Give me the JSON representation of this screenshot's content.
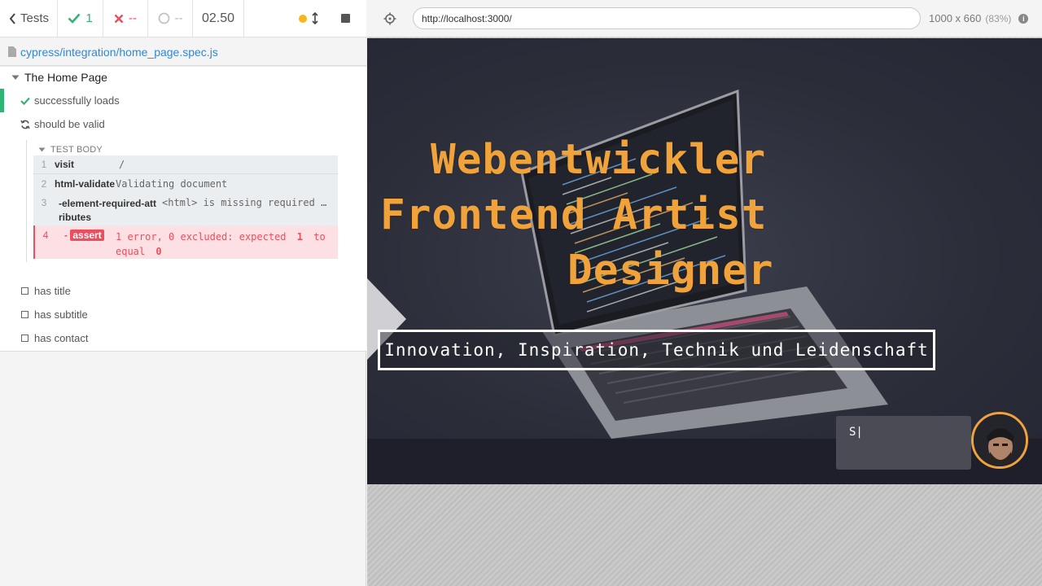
{
  "reporter": {
    "back_label": "Tests",
    "passed_count": "1",
    "failed_count": "--",
    "pending_count": "--",
    "duration": "02.50",
    "spec_path": "cypress/integration/home_page.spec.js",
    "suite_title": "The Home Page",
    "tests": [
      {
        "title": "successfully loads",
        "state": "passed"
      },
      {
        "title": "should be valid",
        "state": "running"
      },
      {
        "title": "has title",
        "state": "pending"
      },
      {
        "title": "has subtitle",
        "state": "pending"
      },
      {
        "title": "has contact",
        "state": "pending"
      }
    ],
    "test_body_label": "TEST BODY",
    "commands": [
      {
        "num": "1",
        "name": "visit",
        "message": "/"
      },
      {
        "num": "2",
        "name": "html-validate",
        "message": "Validating document"
      },
      {
        "num": "3",
        "name": "-element-required-attributes",
        "message": "<html> is missing required …"
      },
      {
        "num": "4",
        "prefix": "-",
        "name": "assert",
        "message": "1 error, 0 excluded: expected",
        "expected": "1",
        "to": "to",
        "equal": "equal",
        "actual": "0"
      }
    ]
  },
  "aut": {
    "url": "http://localhost:3000/",
    "viewport": "1000 x 660",
    "scale": "(83%)",
    "hero_lines": [
      "Webentwickler",
      "Frontend Artist",
      "Designer"
    ],
    "tagline": "Innovation, Inspiration, Technik und Leidenschaft",
    "chat_text": "S|"
  },
  "colors": {
    "pass": "#2bb673",
    "fail": "#e94f5f",
    "running": "#f8b61c",
    "link": "#3386d4",
    "hero_text": "#f0a33b"
  }
}
